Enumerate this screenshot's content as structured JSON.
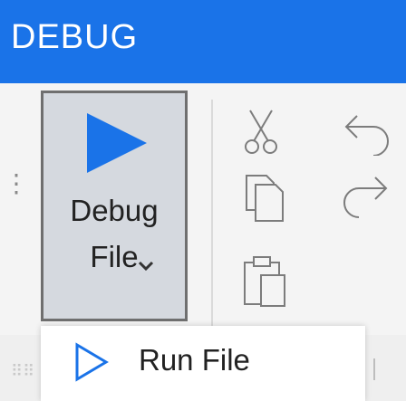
{
  "header": {
    "title": "DEBUG"
  },
  "ribbon": {
    "debug_button": {
      "line1": "Debug",
      "line2": "File"
    },
    "icons": [
      "play-icon",
      "chevron-down-icon",
      "cut-icon",
      "undo-icon",
      "copy-icon",
      "redo-icon",
      "paste-icon"
    ]
  },
  "menu": {
    "items": [
      {
        "label": "Run File",
        "icon": "run-play-outline-icon"
      }
    ]
  },
  "colors": {
    "header_bg": "#1a73e8",
    "accent": "#1a73e8",
    "button_bg": "#d5d9df",
    "button_border": "#6f6f6f"
  }
}
